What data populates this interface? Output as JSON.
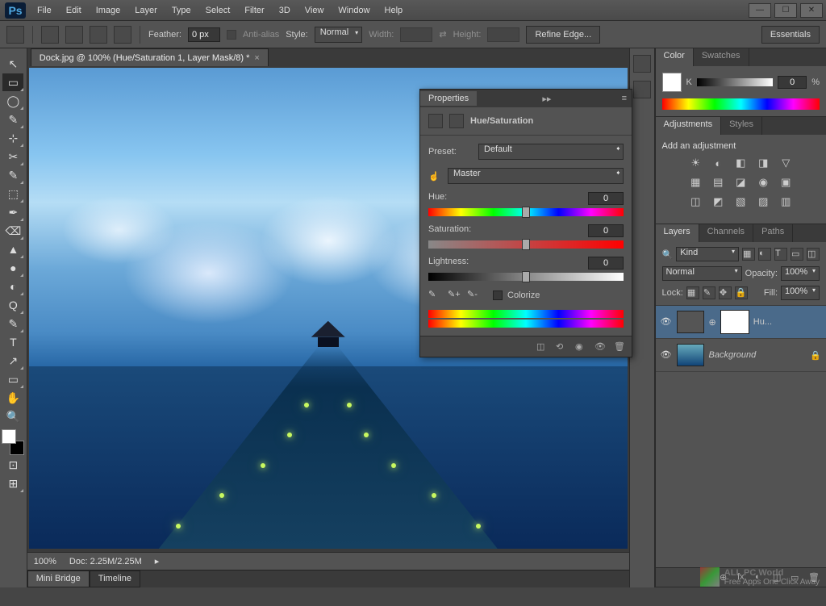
{
  "app": {
    "logo": "Ps"
  },
  "menu": {
    "items": [
      "File",
      "Edit",
      "Image",
      "Layer",
      "Type",
      "Select",
      "Filter",
      "3D",
      "View",
      "Window",
      "Help"
    ]
  },
  "win": {
    "min": "—",
    "max": "☐",
    "close": "✕"
  },
  "options": {
    "feather_label": "Feather:",
    "feather_value": "0 px",
    "antialias": "Anti-alias",
    "style_label": "Style:",
    "style_value": "Normal",
    "width_label": "Width:",
    "height_label": "Height:",
    "refine": "Refine Edge...",
    "essentials": "Essentials"
  },
  "doc": {
    "tab": "Dock.jpg @ 100% (Hue/Saturation 1, Layer Mask/8) *",
    "close": "×"
  },
  "status": {
    "zoom": "100%",
    "doc": "Doc: 2.25M/2.25M",
    "arrow": "▸"
  },
  "bottom": {
    "mini": "Mini Bridge",
    "timeline": "Timeline"
  },
  "color": {
    "tab1": "Color",
    "tab2": "Swatches",
    "channel": "K",
    "value": "0",
    "pct": "%"
  },
  "adjust": {
    "tab1": "Adjustments",
    "tab2": "Styles",
    "label": "Add an adjustment",
    "r1": [
      "☀",
      "◐",
      "◧",
      "◨",
      "▽"
    ],
    "r2": [
      "▦",
      "▤",
      "◪",
      "◉",
      "▣"
    ],
    "r3": [
      "◫",
      "◩",
      "▧",
      "▨",
      "▥"
    ]
  },
  "layers": {
    "tab1": "Layers",
    "tab2": "Channels",
    "tab3": "Paths",
    "kind": "Kind",
    "kind_icon": "🔍",
    "filters": [
      "▦",
      "◐",
      "T",
      "▭",
      "◫"
    ],
    "blend": "Normal",
    "opacity_label": "Opacity:",
    "opacity": "100%",
    "lock_label": "Lock:",
    "lock_icons": [
      "▦",
      "✎",
      "✥",
      "🔒"
    ],
    "fill_label": "Fill:",
    "fill": "100%",
    "layer1": {
      "name": "Hu...",
      "link": "⊕"
    },
    "layer2": {
      "name": "Background",
      "lock": "🔒"
    },
    "footer_icons": [
      "⊕",
      "fx",
      "◐",
      "◫",
      "▭",
      "🗑"
    ]
  },
  "props": {
    "tab": "Properties",
    "title": "Hue/Saturation",
    "preset_label": "Preset:",
    "preset": "Default",
    "channel": "Master",
    "hue_label": "Hue:",
    "hue": "0",
    "sat_label": "Saturation:",
    "sat": "0",
    "light_label": "Lightness:",
    "light": "0",
    "colorize": "Colorize",
    "eyedrops": [
      "✎",
      "✎+",
      "✎-"
    ],
    "footer": [
      "◫",
      "⟲",
      "◉",
      "👁",
      "🗑"
    ],
    "collapse": "▸▸",
    "menu": "≡"
  },
  "watermark": {
    "text": "ALL PC World",
    "sub": "Free Apps One Click Away"
  },
  "tools": {
    "items": [
      "↖",
      "▭",
      "◯",
      "✎",
      "⊹",
      "✂",
      "✎",
      "⬚",
      "✒",
      "⌫",
      "▲",
      "●",
      "◐",
      "Q",
      "✎",
      "T",
      "↗",
      "▭",
      "✋",
      "🔍"
    ],
    "extra": [
      "⊡",
      "⊞",
      "⊟"
    ]
  }
}
